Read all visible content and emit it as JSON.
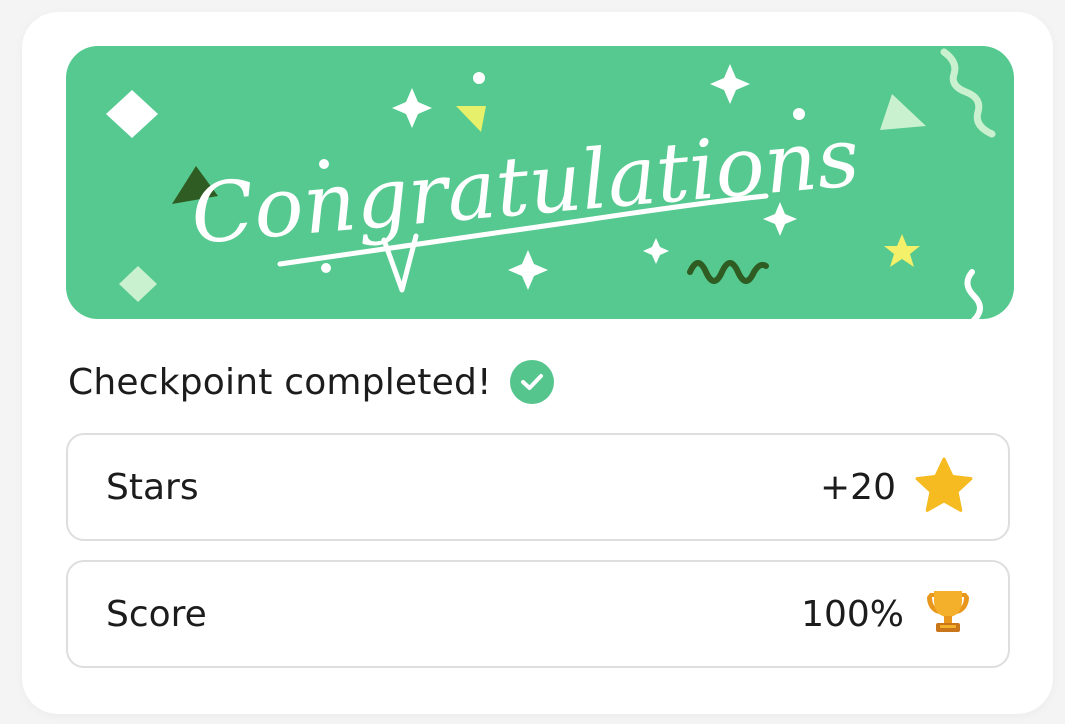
{
  "banner": {
    "text": "Congratulations",
    "background_color": "#55c98f"
  },
  "checkpoint": {
    "title": "Checkpoint completed!",
    "status_icon": "check-circle-icon",
    "status_color": "#55c58d"
  },
  "stats": [
    {
      "label": "Stars",
      "value": "+20",
      "icon": "star-icon",
      "icon_color": "#f6bb20"
    },
    {
      "label": "Score",
      "value": "100%",
      "icon": "trophy-icon",
      "icon_color": "#f0a020"
    }
  ]
}
